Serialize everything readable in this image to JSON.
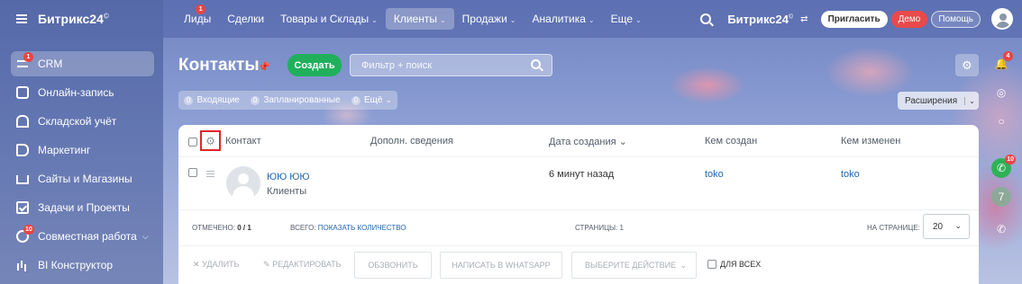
{
  "app": {
    "logo": "Битрикс24",
    "logo_mark": "©"
  },
  "sidebar": {
    "items": [
      {
        "label": "CRM",
        "badge": "1",
        "active": true
      },
      {
        "label": "Онлайн-запись"
      },
      {
        "label": "Складской учёт"
      },
      {
        "label": "Маркетинг"
      },
      {
        "label": "Сайты и Магазины"
      },
      {
        "label": "Задачи и Проекты"
      },
      {
        "label": "Совместная работа",
        "badge": "10",
        "has_chevron": true
      },
      {
        "label": "BI Конструктор"
      }
    ]
  },
  "topnav": {
    "items": [
      {
        "label": "Лиды",
        "badge": "1"
      },
      {
        "label": "Сделки"
      },
      {
        "label": "Товары и Склады",
        "dropdown": true
      },
      {
        "label": "Клиенты",
        "dropdown": true,
        "active": true
      },
      {
        "label": "Продажи",
        "dropdown": true
      },
      {
        "label": "Аналитика",
        "dropdown": true
      },
      {
        "label": "Еще",
        "dropdown": true
      }
    ],
    "logo": "Битрикс24",
    "invite_label": "Пригласить",
    "demo_label": "Демо",
    "help_label": "Помощь"
  },
  "page": {
    "title": "Контакты",
    "create_label": "Создать",
    "filter_placeholder": "Фильтр + поиск",
    "counters": [
      {
        "num": "0",
        "label": "Входящие"
      },
      {
        "num": "0",
        "label": "Запланированные"
      },
      {
        "num": "0",
        "label": "Ещё"
      }
    ],
    "extensions_label": "Расширения"
  },
  "right_rail": {
    "notifications_badge": "4",
    "calls_badge": "10"
  },
  "grid": {
    "columns": [
      "Контакт",
      "Дополн. сведения",
      "Дата создания",
      "Кем создан",
      "Кем изменен"
    ],
    "rows": [
      {
        "name": "ЮЮ ЮЮ",
        "type": "Клиенты",
        "created": "6 минут назад",
        "created_by": "toko",
        "modified_by": "toko"
      }
    ],
    "footer": {
      "marked_label": "Отмечено:",
      "marked_value": "0 / 1",
      "total_label": "Всего:",
      "total_link": "показать количество",
      "pages_label": "Страницы:",
      "pages_value": "1",
      "per_page_label": "На странице:",
      "per_page_value": "20"
    },
    "actions": {
      "delete": "Удалить",
      "edit": "Редактировать",
      "call": "Обзвонить",
      "whatsapp": "Написать в WhatsApp",
      "choose": "Выберите действие",
      "for_all": "Для всех"
    }
  },
  "colors": {
    "accent_green": "#20b05c",
    "badge_red": "#e84545",
    "link_blue": "#2067b0",
    "highlight_red": "#e0242e"
  }
}
